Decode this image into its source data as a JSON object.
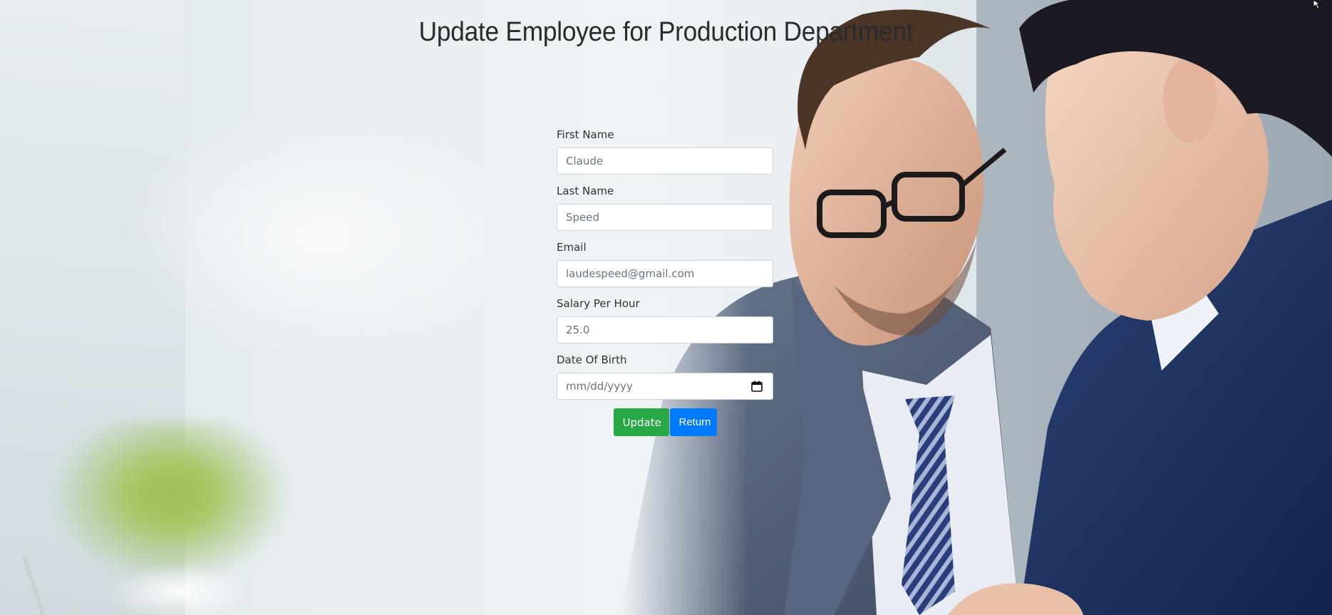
{
  "page": {
    "title": "Update Employee for Production Department"
  },
  "form": {
    "fields": [
      {
        "label": "First Name",
        "value": "Claude"
      },
      {
        "label": "Last Name",
        "value": "Speed"
      },
      {
        "label": "Email",
        "value": "laudespeed@gmail.com"
      },
      {
        "label": "Salary Per Hour",
        "value": "25.0"
      },
      {
        "label": "Date Of Birth",
        "value": "mm/dd/yyyy"
      }
    ],
    "update_label": "Update",
    "return_label": "Return"
  },
  "colors": {
    "update_button": "#28a745",
    "return_button": "#007bff",
    "title_text": "#2b2b2b"
  },
  "icons": {
    "date_picker": "calendar-icon"
  }
}
